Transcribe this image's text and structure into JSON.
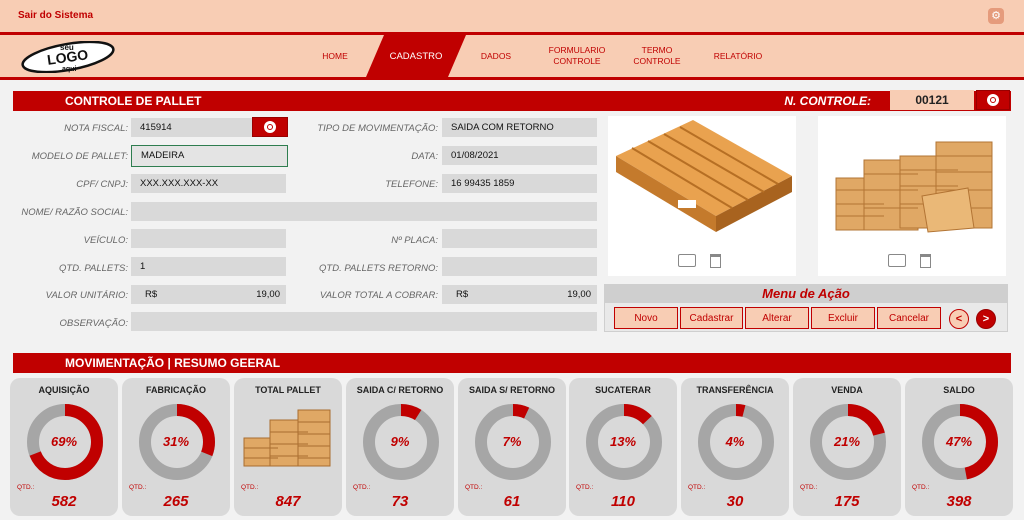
{
  "topbar": {
    "exit_label": "Sair do Sistema",
    "settings_icon": "settings-icon"
  },
  "logo": {
    "line1": "seu",
    "line2": "LOGO",
    "line3": "aqui"
  },
  "nav": {
    "home": "HOME",
    "cadastro": "CADASTRO",
    "dados": "DADOS",
    "formulario_1": "FORMULARIO",
    "formulario_2": "CONTROLE",
    "termo_1": "TERMO",
    "termo_2": "CONTROLE",
    "relatorio": "RELATÓRIO",
    "active": "CADASTRO"
  },
  "header": {
    "title": "CONTROLE DE PALLET",
    "control_label": "N. CONTROLE:",
    "control_value": "00121"
  },
  "form": {
    "nota_fiscal_label": "NOTA  FISCAL:",
    "nota_fiscal": "415914",
    "tipo_mov_label": "TIPO DE MOVIMENTAÇÃO:",
    "tipo_mov": "SAIDA COM RETORNO",
    "modelo_label": "MODELO DE PALLET:",
    "modelo": "MADEIRA",
    "data_label": "DATA:",
    "data": "01/08/2021",
    "cpf_label": "CPF/ CNPJ:",
    "cpf": "XXX.XXX.XXX-XX",
    "telefone_label": "TELEFONE:",
    "telefone": "16 99435 1859",
    "nome_label": "NOME/ RAZÃO SOCIAL:",
    "nome": "",
    "veiculo_label": "VEÍCULO:",
    "veiculo": "",
    "placa_label": "Nº PLACA:",
    "placa": "",
    "qtd_label": "QTD. PALLETS:",
    "qtd": "1",
    "qtd_ret_label": "QTD. PALLETS RETORNO:",
    "qtd_ret": "",
    "valor_unit_label": "VALOR UNITÁRIO:",
    "valor_unit_currency": "R$",
    "valor_unit": "19,00",
    "valor_total_label": "VALOR TOTAL A COBRAR:",
    "valor_total_currency": "R$",
    "valor_total": "19,00",
    "obs_label": "OBSERVAÇÃO:",
    "obs": ""
  },
  "images": {
    "camera_icon": "camera-icon",
    "trash_icon": "trash-icon"
  },
  "menu": {
    "title": "Menu de Ação",
    "novo": "Novo",
    "cadastrar": "Cadastrar",
    "alterar": "Alterar",
    "excluir": "Excluir",
    "cancelar": "Cancelar",
    "prev": "<",
    "next": ">"
  },
  "summary": {
    "title": "MOVIMENTAÇÃO | RESUMO GEERAL",
    "qty_label": "QTD.:",
    "cards": [
      {
        "title": "AQUISIÇÃO",
        "pct": "69%",
        "fraction": 0.69,
        "qty": "582"
      },
      {
        "title": "FABRICAÇÃO",
        "pct": "31%",
        "fraction": 0.31,
        "qty": "265"
      },
      {
        "title": "TOTAL PALLET",
        "pct": "",
        "fraction": 0,
        "qty": "847"
      },
      {
        "title": "SAIDA C/ RETORNO",
        "pct": "9%",
        "fraction": 0.09,
        "qty": "73"
      },
      {
        "title": "SAIDA S/ RETORNO",
        "pct": "7%",
        "fraction": 0.07,
        "qty": "61"
      },
      {
        "title": "SUCATERAR",
        "pct": "13%",
        "fraction": 0.13,
        "qty": "110"
      },
      {
        "title": "TRANSFERÊNCIA",
        "pct": "4%",
        "fraction": 0.04,
        "qty": "30"
      },
      {
        "title": "VENDA",
        "pct": "21%",
        "fraction": 0.21,
        "qty": "175"
      },
      {
        "title": "SALDO",
        "pct": "47%",
        "fraction": 0.47,
        "qty": "398"
      }
    ]
  },
  "colors": {
    "accent": "#c00000",
    "peach": "#f8cdb4",
    "gray": "#d9d9d9",
    "ring_gray": "#a6a6a6"
  }
}
